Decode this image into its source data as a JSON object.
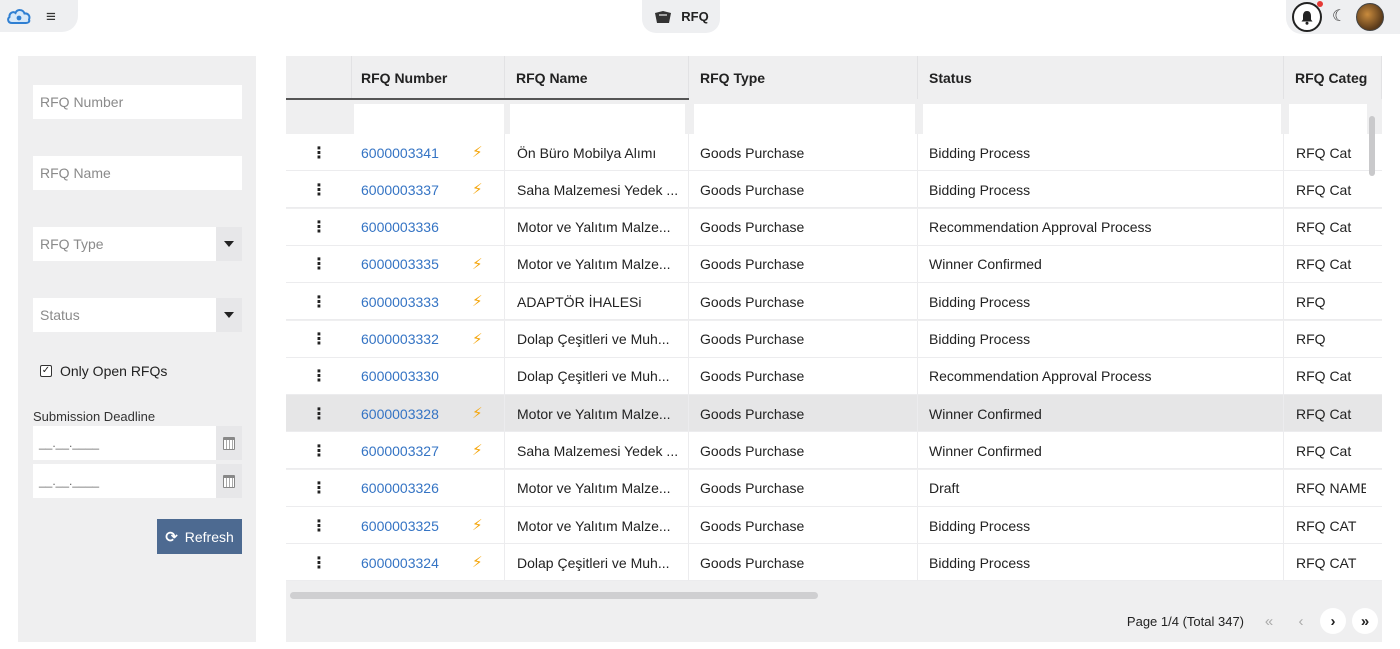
{
  "app": {
    "module_title": "RFQ"
  },
  "filters": {
    "rfq_number_placeholder": "RFQ Number",
    "rfq_name_placeholder": "RFQ Name",
    "rfq_type_placeholder": "RFQ Type",
    "status_placeholder": "Status",
    "only_open_label": "Only Open RFQs",
    "only_open_checked": true,
    "deadline_label": "Submission Deadline",
    "date_placeholder": "__.__.____",
    "refresh_label": "Refresh"
  },
  "grid": {
    "columns": [
      "RFQ Number",
      "RFQ Name",
      "RFQ Type",
      "Status",
      "RFQ Categ"
    ],
    "rows": [
      {
        "number": "6000003341",
        "bolt": true,
        "name": "Ön Büro Mobilya Alımı",
        "type": "Goods Purchase",
        "status": "Bidding Process",
        "category": "RFQ Cat"
      },
      {
        "number": "6000003337",
        "bolt": true,
        "name": "Saha Malzemesi Yedek ...",
        "type": "Goods Purchase",
        "status": "Bidding Process",
        "category": "RFQ Cat"
      },
      {
        "number": "6000003336",
        "bolt": false,
        "name": "Motor ve Yalıtım Malze...",
        "type": "Goods Purchase",
        "status": "Recommendation Approval Process",
        "category": "RFQ Cat"
      },
      {
        "number": "6000003335",
        "bolt": true,
        "name": "Motor ve Yalıtım Malze...",
        "type": "Goods Purchase",
        "status": "Winner Confirmed",
        "category": "RFQ Cat"
      },
      {
        "number": "6000003333",
        "bolt": true,
        "name": "ADAPTÖR İHALESi",
        "type": "Goods Purchase",
        "status": "Bidding Process",
        "category": "RFQ"
      },
      {
        "number": "6000003332",
        "bolt": true,
        "name": "Dolap Çeşitleri ve Muh...",
        "type": "Goods Purchase",
        "status": "Bidding Process",
        "category": "RFQ"
      },
      {
        "number": "6000003330",
        "bolt": false,
        "name": "Dolap Çeşitleri ve Muh...",
        "type": "Goods Purchase",
        "status": "Recommendation Approval Process",
        "category": "RFQ Cat"
      },
      {
        "number": "6000003328",
        "bolt": true,
        "name": "Motor ve Yalıtım Malze...",
        "type": "Goods Purchase",
        "status": "Winner Confirmed",
        "category": "RFQ Cat",
        "selected": true
      },
      {
        "number": "6000003327",
        "bolt": true,
        "name": "Saha Malzemesi Yedek ...",
        "type": "Goods Purchase",
        "status": "Winner Confirmed",
        "category": "RFQ Cat"
      },
      {
        "number": "6000003326",
        "bolt": false,
        "name": "Motor ve Yalıtım Malze...",
        "type": "Goods Purchase",
        "status": "Draft",
        "category": "RFQ NAME"
      },
      {
        "number": "6000003325",
        "bolt": true,
        "name": "Motor ve Yalıtım Malze...",
        "type": "Goods Purchase",
        "status": "Bidding Process",
        "category": "RFQ CAT"
      },
      {
        "number": "6000003324",
        "bolt": true,
        "name": "Dolap Çeşitleri ve Muh...",
        "type": "Goods Purchase",
        "status": "Bidding Process",
        "category": "RFQ CAT"
      }
    ]
  },
  "pagination": {
    "label": "Page 1/4 (Total 347)",
    "first_icon": "double-chevron-left-icon",
    "prev_icon": "chevron-left-icon",
    "next_icon": "chevron-right-icon",
    "last_icon": "double-chevron-right-icon"
  },
  "colors": {
    "link": "#3574c4",
    "bolt": "#f5a70f",
    "refresh_button": "#4d6a91",
    "notification_dot": "#e53935"
  }
}
